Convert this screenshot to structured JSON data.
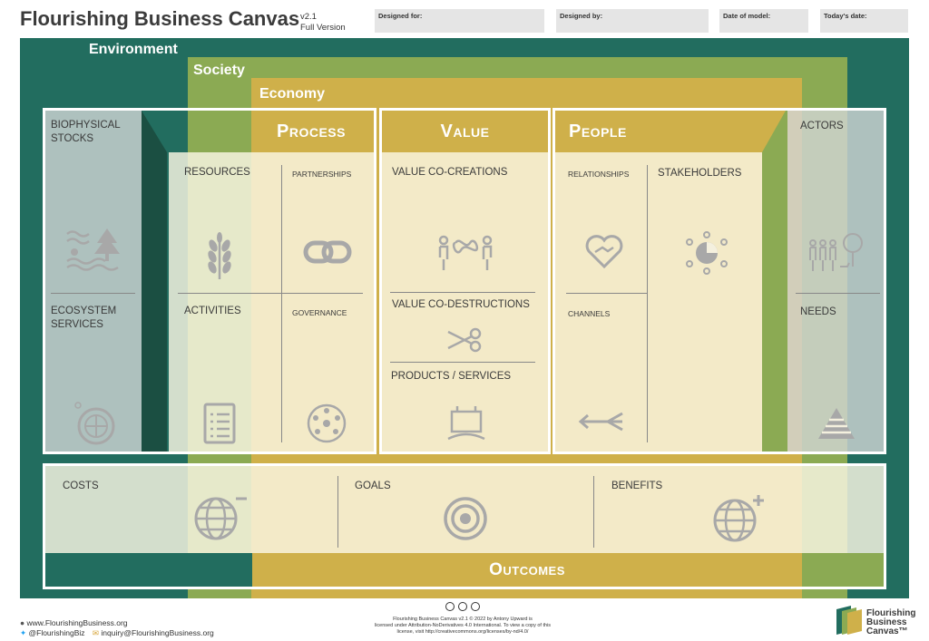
{
  "header": {
    "title": "Flourishing Business Canvas",
    "version": "v2.1",
    "version_note": "Full Version",
    "fields": [
      "Designed for:",
      "Designed by:",
      "Date of model:",
      "Today's date:"
    ]
  },
  "layers": {
    "environment": "Environment",
    "society": "Society",
    "economy": "Economy"
  },
  "sections": {
    "process": "Process",
    "value": "Value",
    "people": "People",
    "outcomes": "Outcomes"
  },
  "blocks": {
    "biophysical_stocks": "BIOPHYSICAL STOCKS",
    "ecosystem_services": "ECOSYSTEM SERVICES",
    "resources": "RESOURCES",
    "partnerships": "PARTNERSHIPS",
    "activities": "ACTIVITIES",
    "governance": "GOVERNANCE",
    "value_co_creations": "VALUE CO-CREATIONS",
    "value_co_destructions": "VALUE CO-DESTRUCTIONS",
    "products_services": "PRODUCTS / SERVICES",
    "relationships": "RELATIONSHIPS",
    "stakeholders": "STAKEHOLDERS",
    "channels": "CHANNELS",
    "actors": "ACTORS",
    "needs": "NEEDS",
    "costs": "COSTS",
    "goals": "GOALS",
    "benefits": "BENEFITS"
  },
  "footer": {
    "website": "www.FlourishingBusiness.org",
    "twitter": "@FlourishingBiz",
    "email": "inquiry@FlourishingBusiness.org",
    "license_line1": "Flourishing Business Canvas v2.1 © 2022 by Antony Upward is",
    "license_line2": "licensed under Attribution-NoDerivatives 4.0 International. To view a copy of this",
    "license_line3": "license, visit http://creativecommons.org/licenses/by-nd/4.0/",
    "logo_line1": "Flourishing",
    "logo_line2": "Business",
    "logo_line3": "Canvas™"
  },
  "colors": {
    "environment": "#226d5f",
    "society": "#8baa53",
    "economy": "#cfb04a",
    "panel": "#faf6e4"
  }
}
